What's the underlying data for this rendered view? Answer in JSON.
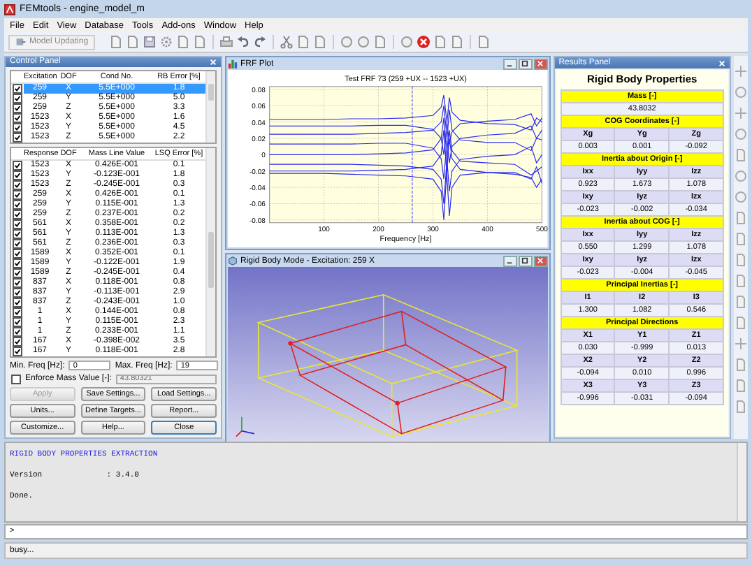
{
  "window": {
    "title": "FEMtools - engine_model_m"
  },
  "menu": [
    "File",
    "Edit",
    "View",
    "Database",
    "Tools",
    "Add-ons",
    "Window",
    "Help"
  ],
  "toolbar": {
    "model_button": {
      "label": "Model Updating",
      "disabled": true
    }
  },
  "control_panel": {
    "title": "Control Panel",
    "excitation": {
      "columns": [
        "Excitation",
        "DOF",
        "Cond No.",
        "RB Error [%]"
      ],
      "rows": [
        {
          "checked": true,
          "selected": true,
          "cells": [
            "259",
            "X",
            "5.5E+000",
            "1.8"
          ]
        },
        {
          "checked": true,
          "selected": false,
          "cells": [
            "259",
            "Y",
            "5.5E+000",
            "5.0"
          ]
        },
        {
          "checked": true,
          "selected": false,
          "cells": [
            "259",
            "Z",
            "5.5E+000",
            "3.3"
          ]
        },
        {
          "checked": true,
          "selected": false,
          "cells": [
            "1523",
            "X",
            "5.5E+000",
            "1.6"
          ]
        },
        {
          "checked": true,
          "selected": false,
          "cells": [
            "1523",
            "Y",
            "5.5E+000",
            "4.5"
          ]
        },
        {
          "checked": true,
          "selected": false,
          "cells": [
            "1523",
            "Z",
            "5.5E+000",
            "2.2"
          ]
        }
      ]
    },
    "response": {
      "columns": [
        "Response",
        "DOF",
        "Mass Line Value",
        "LSQ Error [%]"
      ],
      "rows": [
        {
          "checked": true,
          "cells": [
            "1523",
            "X",
            "0.426E-001",
            "0.1"
          ]
        },
        {
          "checked": true,
          "cells": [
            "1523",
            "Y",
            "-0.123E-001",
            "1.8"
          ]
        },
        {
          "checked": true,
          "cells": [
            "1523",
            "Z",
            "-0.245E-001",
            "0.3"
          ]
        },
        {
          "checked": true,
          "cells": [
            "259",
            "X",
            "0.426E-001",
            "0.1"
          ]
        },
        {
          "checked": true,
          "cells": [
            "259",
            "Y",
            "0.115E-001",
            "1.3"
          ]
        },
        {
          "checked": true,
          "cells": [
            "259",
            "Z",
            "0.237E-001",
            "0.2"
          ]
        },
        {
          "checked": true,
          "cells": [
            "561",
            "X",
            "0.358E-001",
            "0.2"
          ]
        },
        {
          "checked": true,
          "cells": [
            "561",
            "Y",
            "0.113E-001",
            "1.3"
          ]
        },
        {
          "checked": true,
          "cells": [
            "561",
            "Z",
            "0.236E-001",
            "0.3"
          ]
        },
        {
          "checked": true,
          "cells": [
            "1589",
            "X",
            "0.352E-001",
            "0.1"
          ]
        },
        {
          "checked": true,
          "cells": [
            "1589",
            "Y",
            "-0.122E-001",
            "1.9"
          ]
        },
        {
          "checked": true,
          "cells": [
            "1589",
            "Z",
            "-0.245E-001",
            "0.4"
          ]
        },
        {
          "checked": true,
          "cells": [
            "837",
            "X",
            "0.118E-001",
            "0.8"
          ]
        },
        {
          "checked": true,
          "cells": [
            "837",
            "Y",
            "-0.113E-001",
            "2.9"
          ]
        },
        {
          "checked": true,
          "cells": [
            "837",
            "Z",
            "-0.243E-001",
            "1.0"
          ]
        },
        {
          "checked": true,
          "cells": [
            "1",
            "X",
            "0.144E-001",
            "0.8"
          ]
        },
        {
          "checked": true,
          "cells": [
            "1",
            "Y",
            "0.115E-001",
            "2.3"
          ]
        },
        {
          "checked": true,
          "cells": [
            "1",
            "Z",
            "0.233E-001",
            "1.1"
          ]
        },
        {
          "checked": true,
          "cells": [
            "167",
            "X",
            "-0.398E-002",
            "3.5"
          ]
        },
        {
          "checked": true,
          "cells": [
            "167",
            "Y",
            "0.118E-001",
            "2.8"
          ]
        }
      ]
    },
    "min_freq": {
      "label": "Min. Freq [Hz]:",
      "value": "0"
    },
    "max_freq": {
      "label": "Max. Freq [Hz]:",
      "value": "19"
    },
    "enforce_mass": {
      "label": "Enforce Mass Value [-]:",
      "checked": false,
      "value": "43.80321",
      "disabled": true
    },
    "buttons": [
      {
        "label": "Apply",
        "disabled": true
      },
      {
        "label": "Save Settings...",
        "disabled": false
      },
      {
        "label": "Load Settings...",
        "disabled": false
      },
      {
        "label": "Units...",
        "disabled": false
      },
      {
        "label": "Define Targets...",
        "disabled": false
      },
      {
        "label": "Report...",
        "disabled": false
      },
      {
        "label": "Customize...",
        "disabled": false
      },
      {
        "label": "Help...",
        "disabled": false
      },
      {
        "label": "Close",
        "disabled": false
      }
    ]
  },
  "frf_window": {
    "title": "FRF Plot",
    "chart_data": {
      "type": "line",
      "title": "Test FRF 73 (259 +UX -- 1523 +UX)",
      "xlabel": "Frequency [Hz]",
      "x": [
        0,
        50,
        100,
        150,
        200,
        250,
        300,
        315,
        320,
        325,
        330,
        335,
        350,
        400,
        450,
        480,
        490,
        500
      ],
      "series": [
        {
          "values": [
            0.043,
            0.043,
            0.043,
            0.044,
            0.044,
            0.045,
            0.048,
            0.058,
            0.073,
            0.043,
            0.013,
            0.028,
            0.038,
            0.041,
            0.043,
            0.05,
            0.035,
            0.045
          ]
        },
        {
          "values": [
            0.035,
            0.035,
            0.035,
            0.035,
            0.036,
            0.036,
            0.031,
            0.02,
            0.0,
            0.035,
            0.07,
            0.052,
            0.042,
            0.038,
            0.037,
            0.03,
            0.045,
            0.04
          ]
        },
        {
          "values": [
            0.025,
            0.025,
            0.025,
            0.025,
            0.026,
            0.027,
            0.03,
            0.04,
            0.06,
            0.025,
            -0.01,
            0.01,
            0.02,
            0.024,
            0.026,
            0.035,
            0.02,
            0.03
          ]
        },
        {
          "values": [
            0.013,
            0.013,
            0.013,
            0.013,
            0.014,
            0.014,
            0.008,
            -0.005,
            -0.03,
            0.013,
            0.055,
            0.03,
            0.018,
            0.015,
            0.015,
            0.005,
            0.02,
            0.018
          ]
        },
        {
          "values": [
            0.0,
            0.0,
            0.0,
            0.0,
            0.001,
            0.002,
            0.006,
            0.02,
            0.045,
            0.0,
            -0.045,
            -0.02,
            -0.006,
            -0.002,
            0.0,
            0.01,
            -0.01,
            0.0
          ]
        },
        {
          "values": [
            -0.012,
            -0.012,
            -0.012,
            -0.012,
            -0.013,
            -0.014,
            -0.018,
            -0.03,
            -0.06,
            -0.012,
            0.03,
            0.005,
            -0.008,
            -0.01,
            -0.012,
            -0.025,
            -0.02,
            -0.015
          ]
        },
        {
          "values": [
            -0.02,
            -0.02,
            -0.02,
            -0.02,
            -0.019,
            -0.018,
            -0.014,
            0.0,
            0.03,
            -0.02,
            -0.075,
            -0.04,
            -0.025,
            -0.022,
            -0.022,
            -0.03,
            -0.015,
            -0.035
          ]
        },
        {
          "values": [
            -0.023,
            -0.023,
            -0.023,
            -0.024,
            -0.025,
            -0.026,
            -0.03,
            -0.045,
            -0.08,
            -0.023,
            0.02,
            -0.005,
            -0.018,
            -0.022,
            -0.024,
            -0.028,
            -0.04,
            -0.03
          ]
        }
      ],
      "xlim": [
        0,
        500
      ],
      "ylim": [
        -0.08,
        0.08
      ],
      "grid": true,
      "ref_lines": [
        {
          "axis": "x",
          "value": 262
        }
      ],
      "xticks": [
        100,
        200,
        300,
        400,
        500
      ],
      "yticks": [
        0.08,
        0.06,
        0.04,
        0.02,
        0,
        -0.02,
        -0.04,
        -0.06,
        -0.08
      ]
    }
  },
  "rigid_body_window": {
    "title": "Rigid Body Mode - Excitation: 259 X"
  },
  "results_panel": {
    "title": "Results Panel",
    "heading": "Rigid Body Properties",
    "sections": [
      {
        "title": "Mass [-]",
        "rows": [
          {
            "kind": "values",
            "cells": [
              "43.8032"
            ]
          }
        ]
      },
      {
        "title": "COG Coordinates [-]",
        "rows": [
          {
            "kind": "labels",
            "cells": [
              "Xg",
              "Yg",
              "Zg"
            ]
          },
          {
            "kind": "values",
            "cells": [
              "0.003",
              "0.001",
              "-0.092"
            ]
          }
        ]
      },
      {
        "title": "Inertia about Origin [-]",
        "rows": [
          {
            "kind": "labels",
            "cells": [
              "Ixx",
              "Iyy",
              "Izz"
            ]
          },
          {
            "kind": "values",
            "cells": [
              "0.923",
              "1.673",
              "1.078"
            ]
          },
          {
            "kind": "labels",
            "cells": [
              "Ixy",
              "Iyz",
              "Izx"
            ]
          },
          {
            "kind": "values",
            "cells": [
              "-0.023",
              "-0.002",
              "-0.034"
            ]
          }
        ]
      },
      {
        "title": "Inertia about COG [-]",
        "rows": [
          {
            "kind": "labels",
            "cells": [
              "Ixx",
              "Iyy",
              "Izz"
            ]
          },
          {
            "kind": "values",
            "cells": [
              "0.550",
              "1.299",
              "1.078"
            ]
          },
          {
            "kind": "labels",
            "cells": [
              "Ixy",
              "Iyz",
              "Izx"
            ]
          },
          {
            "kind": "values",
            "cells": [
              "-0.023",
              "-0.004",
              "-0.045"
            ]
          }
        ]
      },
      {
        "title": "Principal Inertias [-]",
        "rows": [
          {
            "kind": "labels",
            "cells": [
              "I1",
              "I2",
              "I3"
            ]
          },
          {
            "kind": "values",
            "cells": [
              "1.300",
              "1.082",
              "0.546"
            ]
          }
        ]
      },
      {
        "title": "Principal Directions",
        "rows": [
          {
            "kind": "labels",
            "cells": [
              "X1",
              "Y1",
              "Z1"
            ]
          },
          {
            "kind": "values",
            "cells": [
              "0.030",
              "-0.999",
              "0.013"
            ]
          },
          {
            "kind": "labels",
            "cells": [
              "X2",
              "Y2",
              "Z2"
            ]
          },
          {
            "kind": "values",
            "cells": [
              "-0.094",
              "0.010",
              "0.996"
            ]
          },
          {
            "kind": "labels",
            "cells": [
              "X3",
              "Y3",
              "Z3"
            ]
          },
          {
            "kind": "values",
            "cells": [
              "-0.996",
              "-0.031",
              "-0.094"
            ]
          }
        ]
      }
    ]
  },
  "console": {
    "lines": [
      {
        "kind": "heading",
        "text": "RIGID BODY PROPERTIES EXTRACTION"
      },
      {
        "kind": "plain",
        "text": "Version              : 3.4.0"
      },
      {
        "kind": "plain",
        "text": "Done."
      }
    ],
    "prompt": ">"
  },
  "status_bar": {
    "text": "busy..."
  }
}
